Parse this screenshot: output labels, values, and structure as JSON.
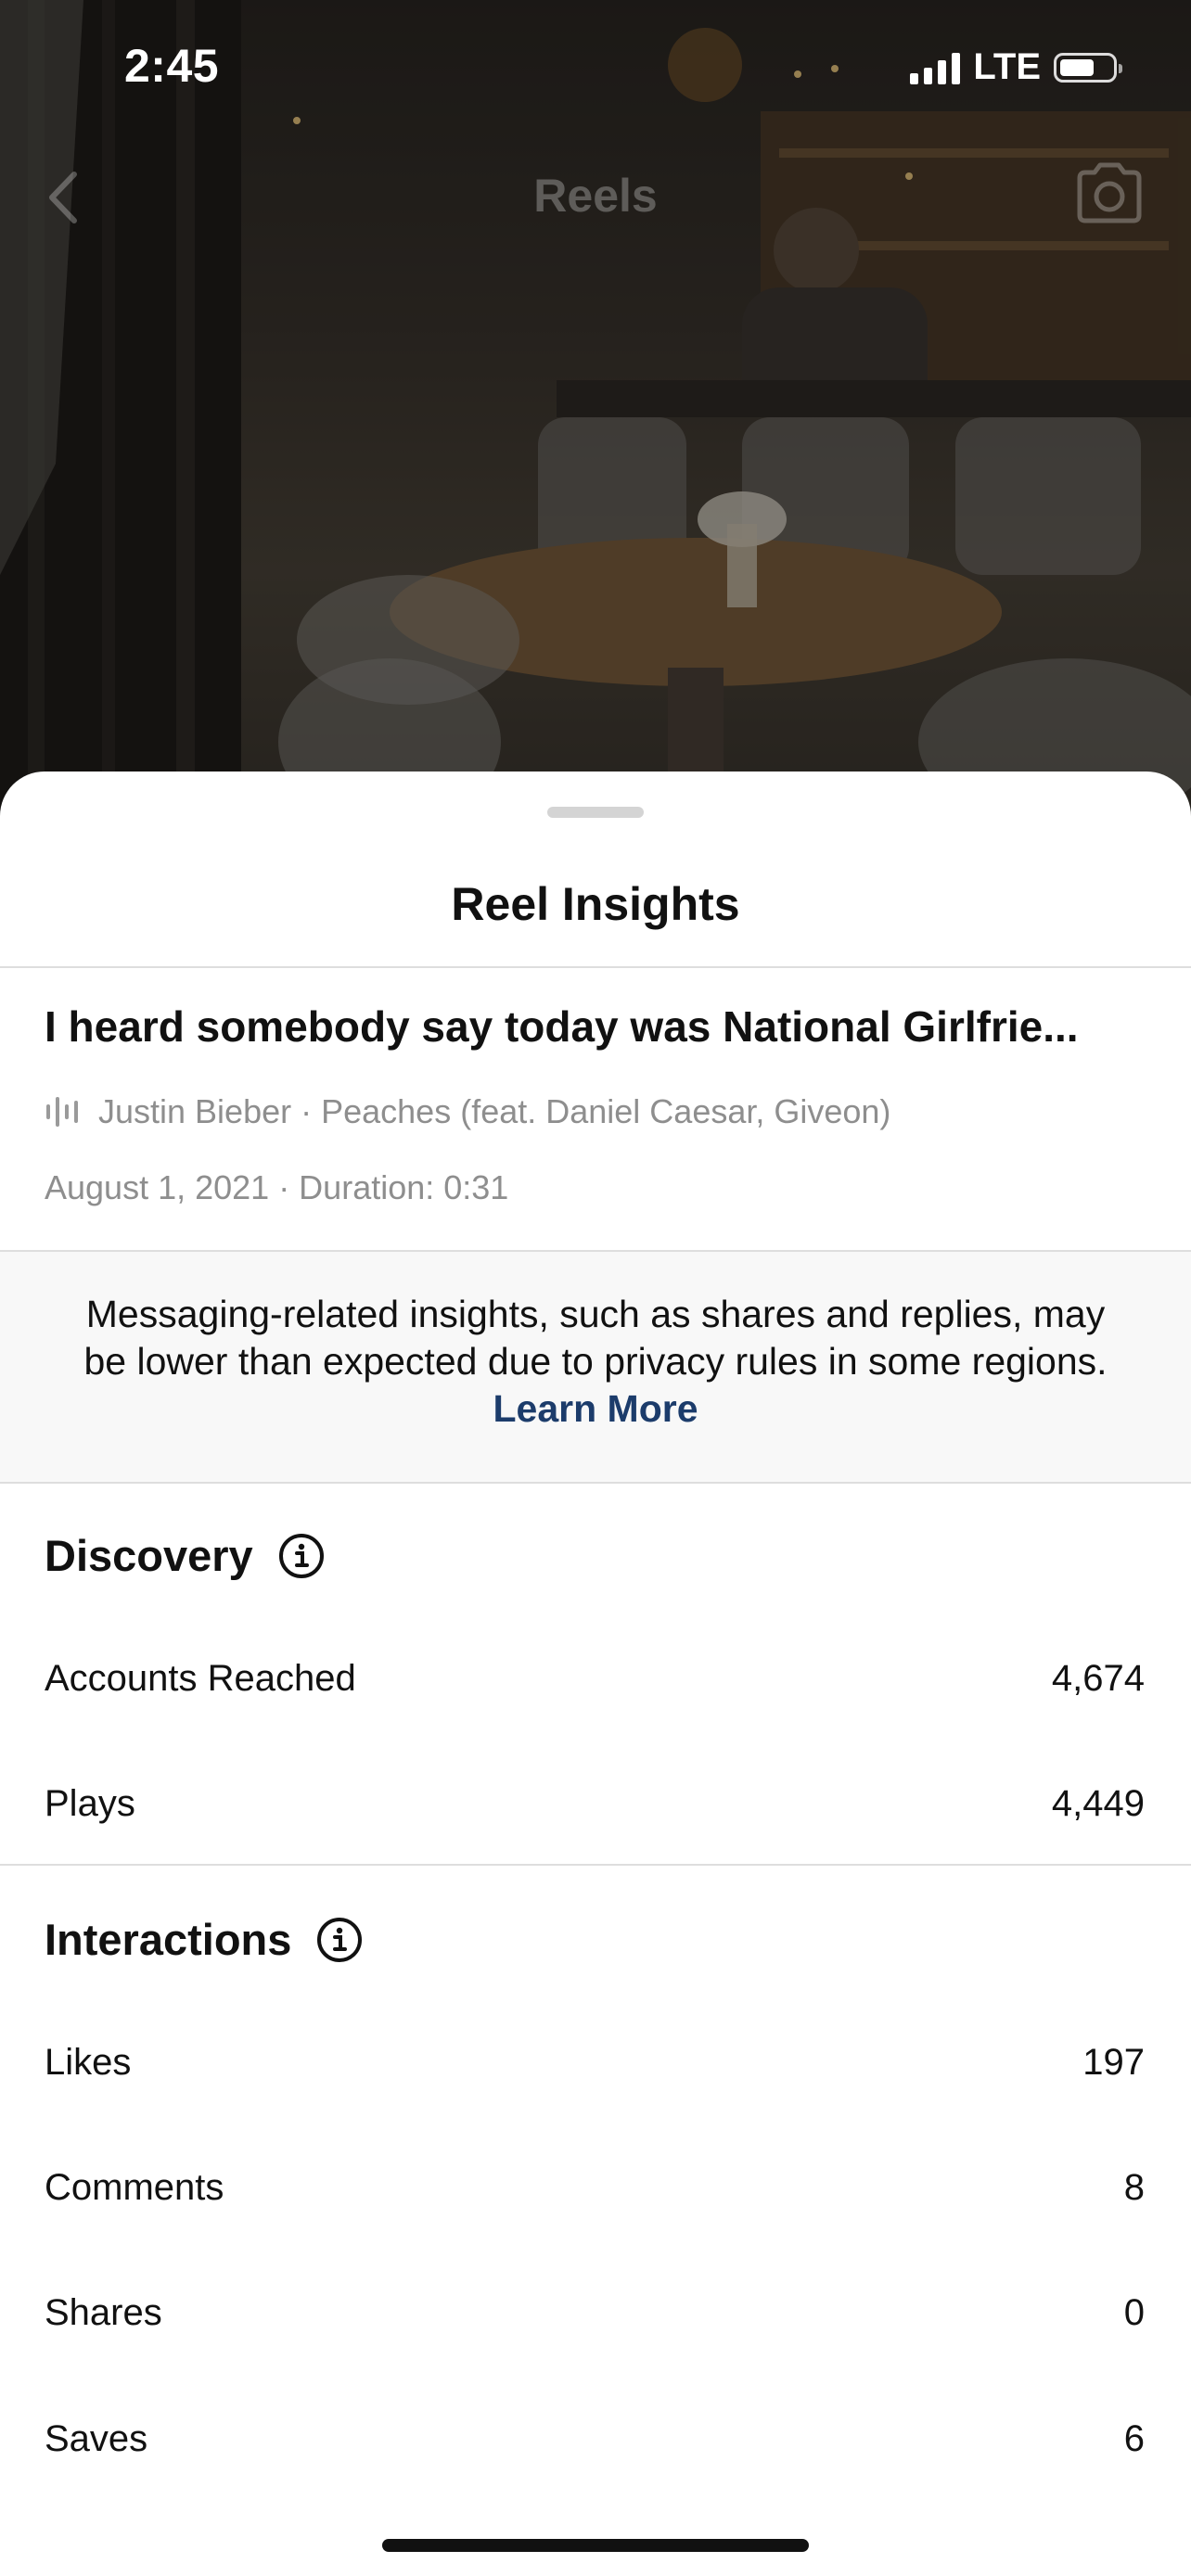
{
  "status_bar": {
    "time": "2:45",
    "network": "LTE"
  },
  "nav": {
    "title": "Reels",
    "back_icon": "chevron-left-icon",
    "camera_icon": "camera-icon"
  },
  "sheet": {
    "title": "Reel Insights",
    "caption": "I heard somebody say today was National Girlfrie...",
    "audio_icon": "audio-waveform-icon",
    "audio": "Justin Bieber · Peaches (feat. Daniel Caesar, Giveon)",
    "date_duration": "August 1, 2021 · Duration: 0:31",
    "notice": {
      "text": "Messaging-related insights, such as shares and replies, may be lower than expected due to privacy rules in some regions. ",
      "link": "Learn More"
    }
  },
  "discovery": {
    "title": "Discovery",
    "metrics": [
      {
        "label": "Accounts Reached",
        "value": "4,674"
      },
      {
        "label": "Plays",
        "value": "4,449"
      }
    ]
  },
  "interactions": {
    "title": "Interactions",
    "metrics": [
      {
        "label": "Likes",
        "value": "197"
      },
      {
        "label": "Comments",
        "value": "8"
      },
      {
        "label": "Shares",
        "value": "0"
      },
      {
        "label": "Saves",
        "value": "6"
      }
    ]
  },
  "colors": {
    "link": "#1c3c6b",
    "secondary_text": "#8e8e8e",
    "notice_bg": "#f8f8f8"
  }
}
